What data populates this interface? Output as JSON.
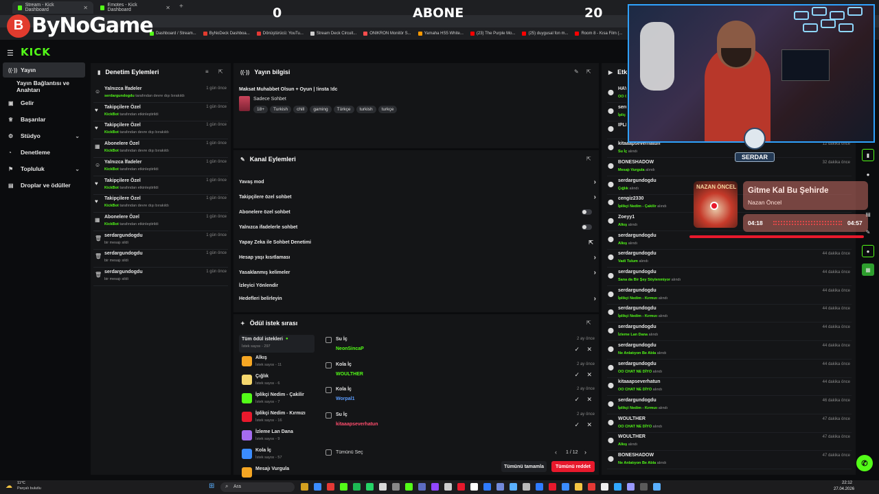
{
  "browser": {
    "tabs": [
      {
        "label": "Stream - Kick Dashboard",
        "close": "✕"
      },
      {
        "label": "Emotes - Kick Dashboard",
        "close": "✕"
      }
    ],
    "new_tab": "+",
    "bookmarks": [
      {
        "label": "Dashboard / Stream...",
        "color": "#53fc18"
      },
      {
        "label": "ByNoDeck Dashboa...",
        "color": "#e23b2e"
      },
      {
        "label": "Dönüştürücü: YouTu...",
        "color": "#e53935"
      },
      {
        "label": "Stream Deck Circuit...",
        "color": "#cccccc"
      },
      {
        "label": "ONIKRON Monitör S...",
        "color": "#ff4d4d"
      },
      {
        "label": "Yamaha HS5 White...",
        "color": "#ff9900"
      },
      {
        "label": "(23) The Purple Mo...",
        "color": "#ff0000"
      },
      {
        "label": "(25) duygusal fon m...",
        "color": "#ff0000"
      },
      {
        "label": "Room 8 - Kısa Film (...",
        "color": "#ff0000"
      }
    ]
  },
  "overlay": {
    "brand": "ByNoGame",
    "brand_initial": "B",
    "left_count": "0",
    "center_label": "ABONE",
    "right_count": "20",
    "badge": "SERDAR"
  },
  "kick": {
    "logo": "KICK"
  },
  "sidebar": {
    "items": [
      {
        "label": "Yayın",
        "icon": "((·))",
        "active": true
      },
      {
        "label": "Yayın Bağlantısı ve Anahtarı",
        "icon": ""
      },
      {
        "label": "Gelir",
        "icon": "▣"
      },
      {
        "label": "Başarılar",
        "icon": "♕"
      },
      {
        "label": "Stüdyo",
        "icon": "⚙",
        "chevron": "⌄"
      },
      {
        "label": "Denetleme",
        "icon": "◔"
      },
      {
        "label": "Topluluk",
        "icon": "⚑",
        "chevron": "⌄"
      },
      {
        "label": "Droplar ve ödüller",
        "icon": "▤"
      }
    ]
  },
  "moderation": {
    "title": "Denetim Eylemleri",
    "rows": [
      {
        "icon": "☺",
        "title": "Yalnızca İfadeler",
        "actor": "serdargundogdu",
        "text": "tarafından devre dışı bırakıldı",
        "time": "1 gün önce"
      },
      {
        "icon": "♥",
        "title": "Takipçilere Özel",
        "actor": "KickBot",
        "text": "tarafından etkinleştirildi",
        "time": "1 gün önce"
      },
      {
        "icon": "♥",
        "title": "Takipçilere Özel",
        "actor": "KickBot",
        "text": "tarafından devre dışı bırakıldı",
        "time": "1 gün önce"
      },
      {
        "icon": "▦",
        "title": "Abonelere Özel",
        "actor": "KickBot",
        "text": "tarafından devre dışı bırakıldı",
        "time": "1 gün önce"
      },
      {
        "icon": "☺",
        "title": "Yalnızca İfadeler",
        "actor": "KickBot",
        "text": "tarafından etkinleştirildi",
        "time": "1 gün önce"
      },
      {
        "icon": "♥",
        "title": "Takipçilere Özel",
        "actor": "KickBot",
        "text": "tarafından etkinleştirildi",
        "time": "1 gün önce"
      },
      {
        "icon": "♥",
        "title": "Takipçilere Özel",
        "actor": "KickBot",
        "text": "tarafından devre dışı bırakıldı",
        "time": "1 gün önce"
      },
      {
        "icon": "▦",
        "title": "Abonelere Özel",
        "actor": "KickBot",
        "text": "tarafından etkinleştirildi",
        "time": "1 gün önce"
      },
      {
        "icon": "🗑",
        "title": "serdargundogdu",
        "actor": "",
        "text": "bir mesajı sildi",
        "time": "1 gün önce"
      },
      {
        "icon": "🗑",
        "title": "serdargundogdu",
        "actor": "",
        "text": "bir mesajı sildi",
        "time": "1 gün önce"
      },
      {
        "icon": "🗑",
        "title": "serdargundogdu",
        "actor": "",
        "text": "bir mesajı sildi",
        "time": "1 gün önce"
      }
    ]
  },
  "stream_info": {
    "title": "Yayın bilgisi",
    "stream_title": "Maksat Muhabbet Olsun + Oyun | !insta !dc",
    "category": "Sadece Sohbet",
    "tags": [
      "18+",
      "Turkish",
      "chill",
      "gaming",
      "Türkçe",
      "turkish",
      "turkçe"
    ]
  },
  "channel_actions": {
    "title": "Kanal Eylemleri",
    "rows": [
      {
        "label": "Yavaş mod",
        "control": "chevron"
      },
      {
        "label": "Takipçilere özel sohbet",
        "control": "chevron"
      },
      {
        "label": "Abonelere özel sohbet",
        "control": "toggle"
      },
      {
        "label": "Yalnızca ifadelerle sohbet",
        "control": "toggle"
      },
      {
        "label": "Yapay Zeka ile Sohbet Denetimi",
        "control": "external"
      },
      {
        "label": "Hesap yaşı kısıtlaması",
        "control": "chevron"
      },
      {
        "label": "Yasaklanmış kelimeler",
        "control": "chevron"
      },
      {
        "label": "İzleyici Yönlendir",
        "control": "none"
      },
      {
        "label": "Hedefleri belirleyin",
        "control": "chevron"
      }
    ]
  },
  "rewards": {
    "title": "Ödül istek sırası",
    "list": [
      {
        "name": "Tüm ödül istekleri",
        "count": "İstek sayısı - 297",
        "color": "",
        "dot": "●"
      },
      {
        "name": "Alkış",
        "count": "İstek sayısı - 11",
        "color": "#f5a623"
      },
      {
        "name": "Çığlık",
        "count": "İstek sayısı - 6",
        "color": "#f5d76e"
      },
      {
        "name": "İplikçi Nedim - Çakilir",
        "count": "İstek sayısı - 7",
        "color": "#53fc18"
      },
      {
        "name": "İplikçi Nedim - Kırmızı",
        "count": "İstek sayısı - 16",
        "color": "#e8192c"
      },
      {
        "name": "İzleme Lan Dana",
        "count": "İstek sayısı - 9",
        "color": "#a56cf0"
      },
      {
        "name": "Kola İç",
        "count": "İstek sayısı - 57",
        "color": "#3b8cff"
      },
      {
        "name": "Mesajı Vurgula",
        "count": "",
        "color": "#f5a623"
      }
    ],
    "queue": [
      {
        "title": "Su İç",
        "user": "NeonSincaP",
        "user_color": "#53fc18",
        "time": "2 ay önce"
      },
      {
        "title": "Kola İç",
        "user": "WOULTHER",
        "user_color": "#53fc18",
        "time": "2 ay önce"
      },
      {
        "title": "Kola İç",
        "user": "Worpal1",
        "user_color": "#5c9dff",
        "time": "2 ay önce"
      },
      {
        "title": "Su İç",
        "user": "kitaaapseverhatun",
        "user_color": "#ff4d6d",
        "time": "2 ay önce"
      }
    ],
    "select_all": "Tümünü Seç",
    "page": "1 / 12",
    "complete_all": "Tümünü tamamla",
    "reject_all": "Tümünü reddet"
  },
  "events": {
    "title": "Etk",
    "rows": [
      {
        "user": "HAY",
        "reward": "OO C",
        "suffix": "",
        "time": ""
      },
      {
        "user": "serd",
        "reward": "İpliç",
        "suffix": "",
        "time": ""
      },
      {
        "user": "IPLIK",
        "reward": "",
        "suffix": "",
        "time": ""
      },
      {
        "user": "kitaaapseverhatun",
        "reward": "Su İç",
        "suffix": "alındı",
        "time": "12 dakika önce"
      },
      {
        "user": "BONESHADOW",
        "reward": "Mesajı Vurgula",
        "suffix": "alındı",
        "time": "32 dakika önce"
      },
      {
        "user": "serdargundogdu",
        "reward": "Çığlık",
        "suffix": "alındı",
        "time": ""
      },
      {
        "user": "cengiz2330",
        "reward": "İplikçi Nedim - Çakilir",
        "suffix": "alındı",
        "time": ""
      },
      {
        "user": "Zoeyy1",
        "reward": "Alkış",
        "suffix": "alındı",
        "time": ""
      },
      {
        "user": "serdargundogdu",
        "reward": "Alkış",
        "suffix": "alındı",
        "time": ""
      },
      {
        "user": "serdargundogdu",
        "reward": "Vadi Tulum",
        "suffix": "alındı",
        "time": "44 dakika önce"
      },
      {
        "user": "serdargundogdu",
        "reward": "Sana da Bir Şey Söylenmiyor",
        "suffix": "alındı",
        "time": "44 dakika önce"
      },
      {
        "user": "serdargundogdu",
        "reward": "İplikçi Nedim - Kırmızı",
        "suffix": "alındı",
        "time": "44 dakika önce"
      },
      {
        "user": "serdargundogdu",
        "reward": "İplikçi Nedim - Kırmızı",
        "suffix": "alındı",
        "time": "44 dakika önce"
      },
      {
        "user": "serdargundogdu",
        "reward": "İzleme Lan Dana",
        "suffix": "alındı",
        "time": "44 dakika önce"
      },
      {
        "user": "serdargundogdu",
        "reward": "Ne Anlatıyon Be Abla",
        "suffix": "alındı",
        "time": "44 dakika önce"
      },
      {
        "user": "serdargundogdu",
        "reward": "OO CHAT NE DİYO",
        "suffix": "alındı",
        "time": "44 dakika önce"
      },
      {
        "user": "kitaaapseverhatun",
        "reward": "OO CHAT NE DİYO",
        "suffix": "alındı",
        "time": "44 dakika önce"
      },
      {
        "user": "serdargundogdu",
        "reward": "İplikçi Nedim - Kırmızı",
        "suffix": "alındı",
        "time": "46 dakika önce"
      },
      {
        "user": "WOULTHER",
        "reward": "OO CHAT NE DİYO",
        "suffix": "alındı",
        "time": "47 dakika önce"
      },
      {
        "user": "WOULTHER",
        "reward": "Alkış",
        "suffix": "alındı",
        "time": "47 dakika önce"
      },
      {
        "user": "BONESHADOW",
        "reward": "Ne Anlatıyon Be Abla",
        "suffix": "alındı",
        "time": "47 dakika önce"
      }
    ]
  },
  "now_playing": {
    "title": "Gitme Kal Bu Şehirde",
    "artist": "Nazan Öncel",
    "art_text": "NAZAN ÖNCEL",
    "current": "04:18",
    "duration": "04:57",
    "progress": 0.87
  },
  "taskbar": {
    "weather_temp": "11°C",
    "weather_desc": "Parçalı bulutlu",
    "search": "Ara",
    "time": "22:12",
    "date": "27.04.2026"
  }
}
